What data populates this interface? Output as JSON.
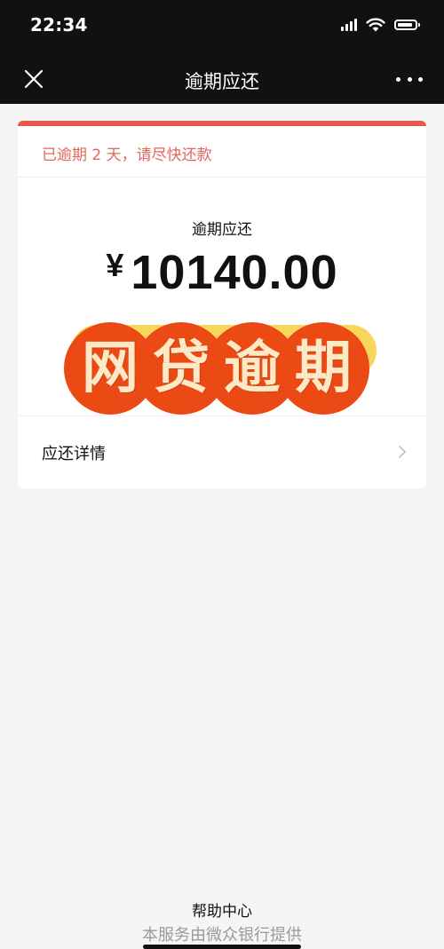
{
  "status_bar": {
    "time": "22:34",
    "icons": [
      "signal-icon",
      "wifi-icon",
      "battery-icon"
    ]
  },
  "nav": {
    "title": "逾期应还",
    "close_icon": "close-icon",
    "more_icon": "more-icon"
  },
  "card": {
    "notice": "已逾期 2 天，请尽快还款",
    "amount_label": "逾期应还",
    "currency": "¥",
    "amount": "10140.00",
    "overlay_chars": [
      "网",
      "贷",
      "逾",
      "期"
    ],
    "details_label": "应还详情",
    "details_icon": "chevron-right-icon"
  },
  "footer": {
    "help": "帮助中心",
    "service_note": "本服务由微众银行提供"
  },
  "colors": {
    "accent_red": "#e45a4c",
    "notice_red": "#e2665a",
    "button_yellow": "#f8d55c",
    "stamp_orange": "#ec4a14",
    "stamp_text": "#fde9c6",
    "header_bg": "#111111",
    "page_bg": "#f5f5f5"
  }
}
